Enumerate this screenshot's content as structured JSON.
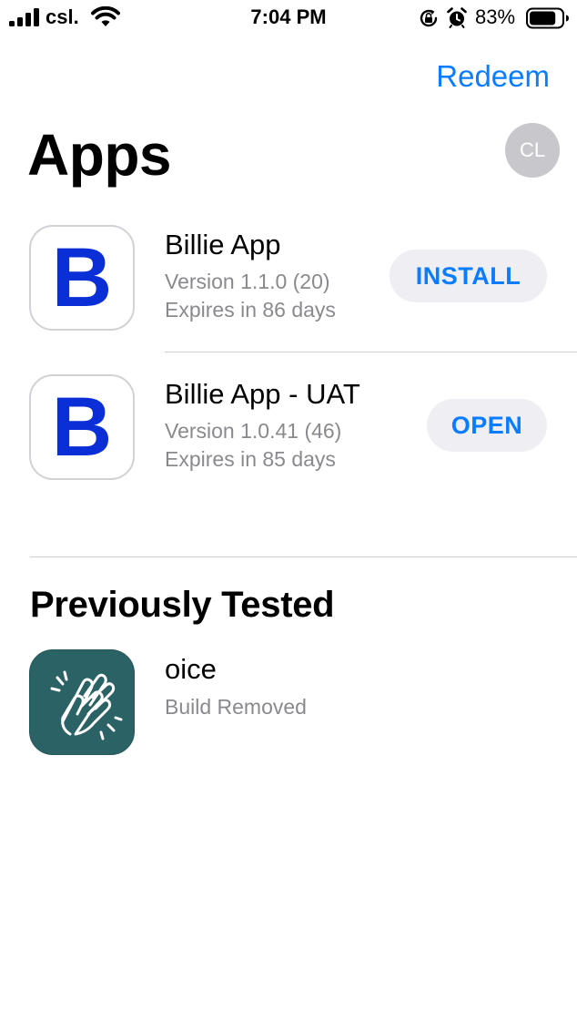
{
  "status_bar": {
    "carrier": "csl.",
    "time": "7:04 PM",
    "battery_percent": "83%",
    "battery_level": 0.83,
    "icons": [
      "signal-icon",
      "wifi-icon",
      "lock-rotation-icon",
      "alarm-icon",
      "battery-icon"
    ]
  },
  "nav": {
    "redeem_label": "Redeem"
  },
  "header": {
    "title": "Apps",
    "avatar_initials": "CL"
  },
  "apps": [
    {
      "name": "Billie App",
      "version": "Version 1.1.0 (20)",
      "expiry": "Expires in 86 days",
      "action_label": "INSTALL",
      "icon_letter": "B"
    },
    {
      "name": "Billie App - UAT",
      "version": "Version 1.0.41 (46)",
      "expiry": "Expires in 85 days",
      "action_label": "OPEN",
      "icon_letter": "B"
    }
  ],
  "previously_tested": {
    "title": "Previously Tested",
    "items": [
      {
        "name": "oice",
        "status": "Build Removed",
        "icon": "clapping-hands-icon"
      }
    ]
  },
  "colors": {
    "accent": "#0a7cff",
    "billie_blue": "#0a2fd6",
    "oice_teal": "#2b6266",
    "pill_bg": "#eeeef3",
    "secondary_text": "#8a8a8e",
    "avatar_bg": "#c7c7cc"
  }
}
